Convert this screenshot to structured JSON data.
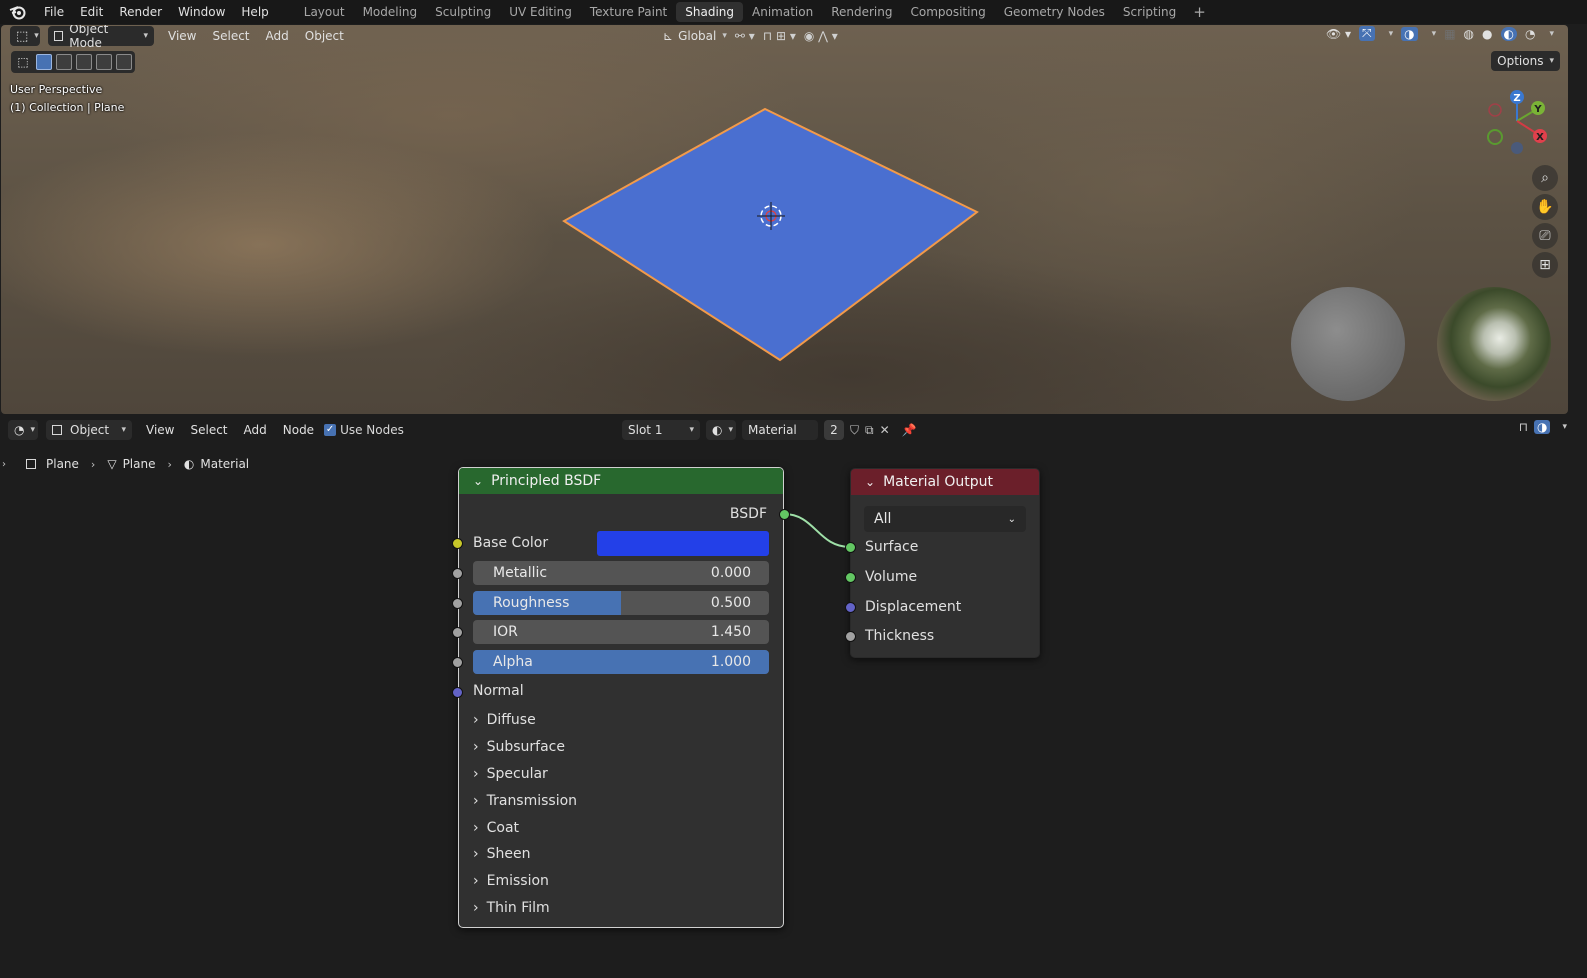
{
  "menu": {
    "logo_icon": "blender-logo-icon",
    "items": [
      "File",
      "Edit",
      "Render",
      "Window",
      "Help"
    ]
  },
  "workspaces": {
    "tabs": [
      "Layout",
      "Modeling",
      "Sculpting",
      "UV Editing",
      "Texture Paint",
      "Shading",
      "Animation",
      "Rendering",
      "Compositing",
      "Geometry Nodes",
      "Scripting"
    ],
    "active": "Shading",
    "add_label": "+"
  },
  "viewport": {
    "mode_label": "Object Mode",
    "menus": [
      "View",
      "Select",
      "Add",
      "Object"
    ],
    "transform_orientation": "Global",
    "options_label": "Options",
    "overlay_line1": "User Perspective",
    "overlay_line2": "(1) Collection | Plane",
    "gizmo": {
      "z": "Z",
      "y": "Y",
      "x": "X"
    },
    "plane_color": "#4a6fd0",
    "outline_color": "#f29a4a"
  },
  "node_editor": {
    "type_label": "Object",
    "menus": [
      "View",
      "Select",
      "Add",
      "Node"
    ],
    "use_nodes_label": "Use Nodes",
    "use_nodes_checked": true,
    "slot_label": "Slot 1",
    "material_name": "Material",
    "material_users": "2",
    "breadcrumb": [
      "Plane",
      "Plane",
      "Material"
    ]
  },
  "bsdf_node": {
    "title": "Principled BSDF",
    "header_color": "#28682e",
    "output_label": "BSDF",
    "base_color_label": "Base Color",
    "base_color_value": "#2340e8",
    "fields": [
      {
        "label": "Metallic",
        "value": "0.000",
        "fill": 0.0
      },
      {
        "label": "Roughness",
        "value": "0.500",
        "fill": 0.5
      },
      {
        "label": "IOR",
        "value": "1.450",
        "fill": 0.0
      },
      {
        "label": "Alpha",
        "value": "1.000",
        "fill": 1.0
      }
    ],
    "normal_label": "Normal",
    "panels": [
      "Diffuse",
      "Subsurface",
      "Specular",
      "Transmission",
      "Coat",
      "Sheen",
      "Emission",
      "Thin Film"
    ]
  },
  "output_node": {
    "title": "Material Output",
    "header_color": "#6b1f2a",
    "target": "All",
    "inputs": [
      "Surface",
      "Volume",
      "Displacement",
      "Thickness"
    ]
  }
}
